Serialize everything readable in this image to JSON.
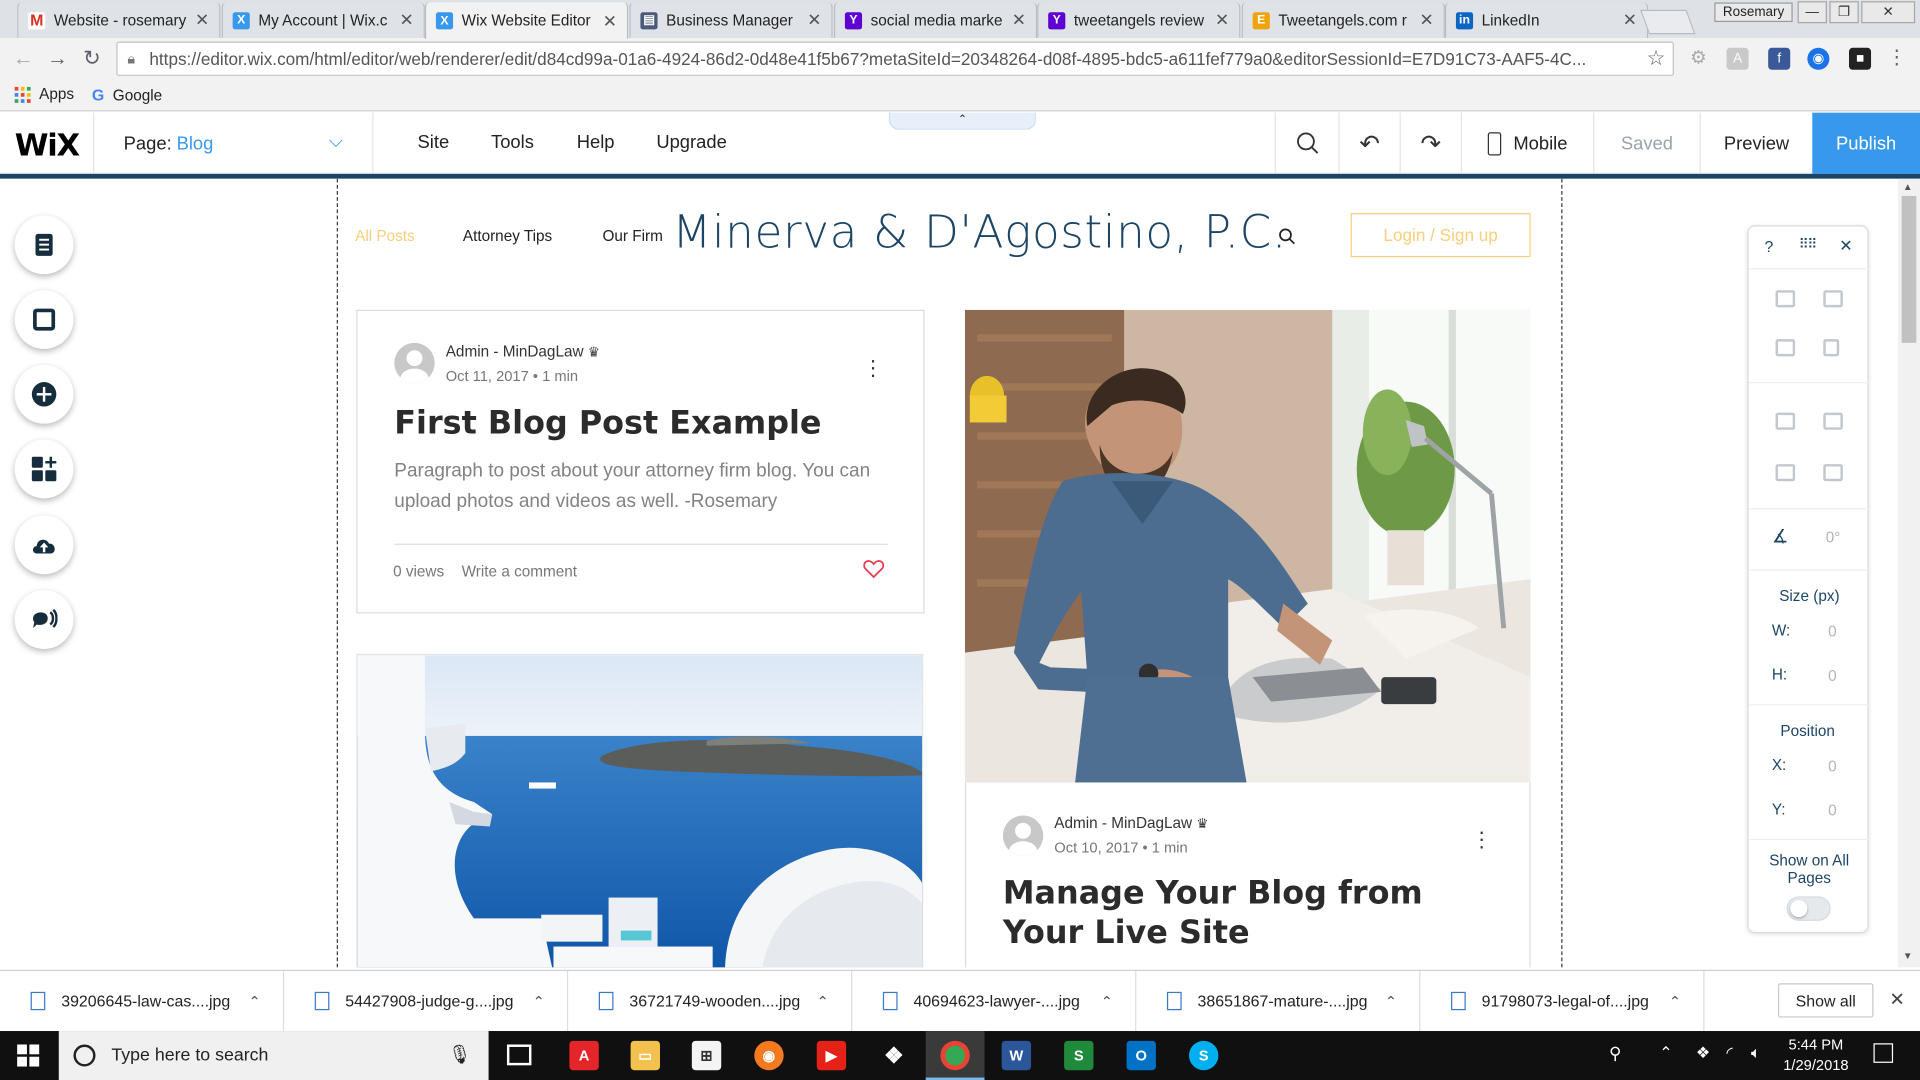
{
  "browser": {
    "tabs": [
      {
        "title": "Website - rosemary",
        "icon": "gmail-icon",
        "color": "#d93025"
      },
      {
        "title": "My Account | Wix.c",
        "icon": "wix-icon",
        "color": "#3899ec"
      },
      {
        "title": "Wix Website Editor",
        "icon": "wix-icon",
        "color": "#3899ec",
        "active": true
      },
      {
        "title": "Business Manager",
        "icon": "business-manager-icon",
        "color": "#4a5a78"
      },
      {
        "title": "social media marke",
        "icon": "yahoo-icon",
        "color": "#5f01d1"
      },
      {
        "title": "tweetangels review",
        "icon": "yahoo-icon",
        "color": "#5f01d1"
      },
      {
        "title": "Tweetangels.com r",
        "icon": "e-icon",
        "color": "#f0a30a"
      },
      {
        "title": "LinkedIn",
        "icon": "linkedin-icon",
        "color": "#0a66c2"
      }
    ],
    "profile": "Rosemary",
    "url": "https://editor.wix.com/html/editor/web/renderer/edit/d84cd99a-01a6-4924-86d2-0d48e41f5b67?metaSiteId=20348264-d08f-4895-bdc5-a611fef779a0&editorSessionId=E7D91C73-AAF5-4C...",
    "bookmarks": [
      {
        "label": "Apps",
        "icon": "apps-grid-icon"
      },
      {
        "label": "Google",
        "icon": "google-icon"
      }
    ]
  },
  "wix": {
    "logo": "WiX",
    "page_label": "Page:",
    "page_value": "Blog",
    "menu": [
      "Site",
      "Tools",
      "Help",
      "Upgrade"
    ],
    "mobile_label": "Mobile",
    "saved_label": "Saved",
    "preview_label": "Preview",
    "publish_label": "Publish"
  },
  "site": {
    "nav": [
      "All Posts",
      "Attorney Tips",
      "Our Firm"
    ],
    "title": "Minerva & D'Agostino, P.C.",
    "login": "Login / Sign up",
    "posts": [
      {
        "author": "Admin - MinDagLaw",
        "date": "Oct 11, 2017",
        "read": "1 min",
        "title": "First Blog Post Example",
        "body": "Paragraph to post about your attorney firm blog. You can upload photos and videos as well. -Rosemary",
        "views": "0 views",
        "comment": "Write a comment"
      },
      {
        "author": "Admin - MinDagLaw",
        "date": "Oct 10, 2017",
        "read": "1 min",
        "title": "Manage Your Blog from Your Live Site"
      }
    ]
  },
  "tool_panel": {
    "help": "?",
    "rotation": "0°",
    "size_title": "Size (px)",
    "w_label": "W:",
    "w_value": "0",
    "h_label": "H:",
    "h_value": "0",
    "position_title": "Position",
    "x_label": "X:",
    "x_value": "0",
    "y_label": "Y:",
    "y_value": "0",
    "show_all": "Show on All Pages"
  },
  "downloads": {
    "items": [
      "39206645-law-cas....jpg",
      "54427908-judge-g....jpg",
      "36721749-wooden....jpg",
      "40694623-lawyer-....jpg",
      "38651867-mature-....jpg",
      "91798073-legal-of....jpg"
    ],
    "show_all": "Show all"
  },
  "taskbar": {
    "search_placeholder": "Type here to search",
    "time": "5:44 PM",
    "date": "1/29/2018"
  }
}
